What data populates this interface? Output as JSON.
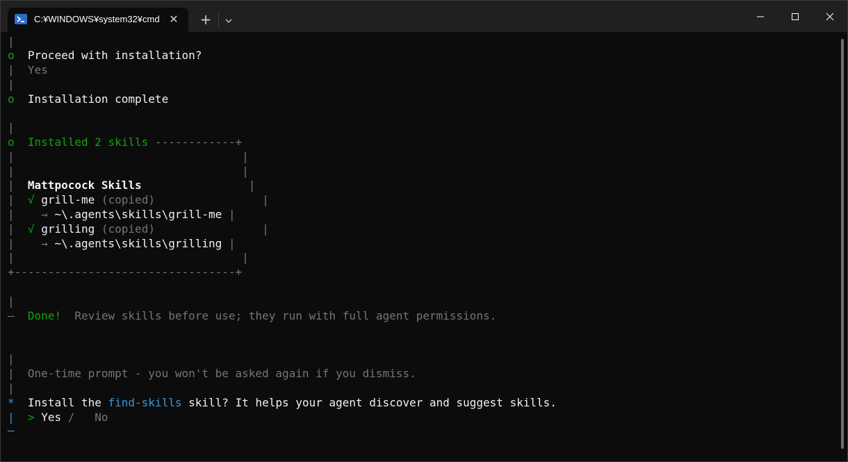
{
  "window": {
    "tab_title": "C:¥WINDOWS¥system32¥cmd",
    "tab_close": "✕",
    "new_tab": "+",
    "dropdown": "⌄"
  },
  "colors": {
    "background": "#0c0c0c",
    "titlebar": "#202020",
    "green": "#13a10e",
    "gray": "#767676",
    "blue": "#3a96dd"
  },
  "terminal": {
    "l0": "|",
    "l1_marker": "o",
    "l1_text": "Proceed with installation?",
    "l2_bar": "|",
    "l2_text": "Yes",
    "l3": "|",
    "l4_marker": "o",
    "l4_text": "Installation complete",
    "l6": "|",
    "l7_marker": "o",
    "l7_title": "Installed 2 skills",
    "l7_rule": " ------------+",
    "box_side": "|",
    "group_title": "Mattpocock Skills",
    "skills": [
      {
        "check": "√",
        "name": "grill-me",
        "status": "(copied)",
        "arrow": "→",
        "path": "~\\.agents\\skills\\grill-me"
      },
      {
        "check": "√",
        "name": "grilling",
        "status": "(copied)",
        "arrow": "→",
        "path": "~\\.agents\\skills\\grilling"
      }
    ],
    "box_bottom": "+---------------------------------+",
    "l20": "|",
    "l21_marker": "—",
    "l21_done": "Done!",
    "l21_text": "Review skills before use; they run with full agent permissions.",
    "l24": "|",
    "l25_text": "One-time prompt - you won't be asked again if you dismiss.",
    "l26": "|",
    "l27_marker": "*",
    "l27_pre": "Install the ",
    "l27_link": "find-skills",
    "l27_post": " skill? It helps your agent discover and suggest skills.",
    "l28_bar": "|",
    "l28_caret": ">",
    "l28_yes": "Yes",
    "l28_slash": "/",
    "l28_no": "No",
    "l29": "—"
  }
}
